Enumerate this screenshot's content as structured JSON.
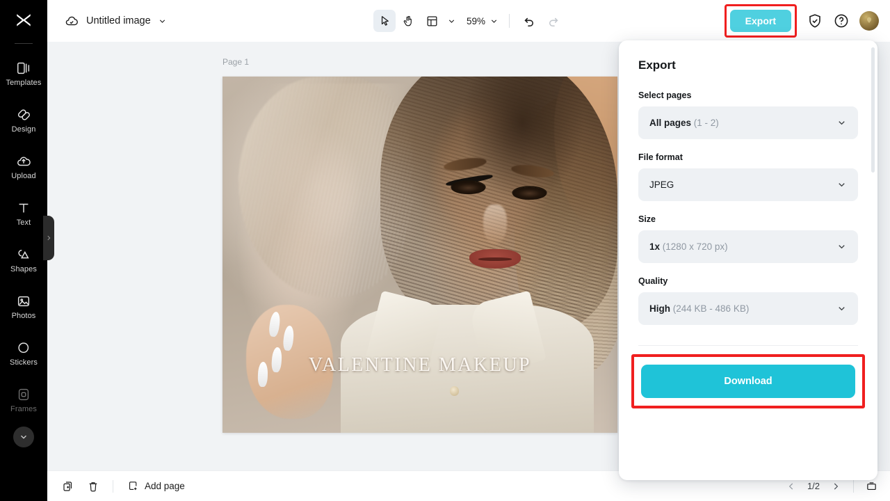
{
  "app": {
    "logo": "capcut-logo-icon"
  },
  "topbar": {
    "cloud_icon": "cloud-check-icon",
    "doc_title": "Untitled image",
    "title_chevron": "chevron-down-icon",
    "tools": [
      {
        "name": "select-tool",
        "icon": "cursor-arrow-icon"
      },
      {
        "name": "hand-tool",
        "icon": "hand-icon"
      },
      {
        "name": "layout-tool",
        "icon": "layout-grid-icon"
      }
    ],
    "zoom_level": "59%",
    "undo_icon": "undo-arrow-icon",
    "redo_icon": "redo-arrow-icon",
    "export_label": "Export",
    "shield_icon": "shield-check-icon",
    "help_icon": "question-circle-icon",
    "avatar": "user-avatar"
  },
  "sidebar": {
    "items": [
      {
        "label": "Templates",
        "icon": "templates-icon",
        "dim": false
      },
      {
        "label": "Design",
        "icon": "design-icon",
        "dim": false
      },
      {
        "label": "Upload",
        "icon": "upload-cloud-icon",
        "dim": false
      },
      {
        "label": "Text",
        "icon": "text-t-icon",
        "dim": false
      },
      {
        "label": "Shapes",
        "icon": "shapes-icon",
        "dim": false
      },
      {
        "label": "Photos",
        "icon": "photos-image-icon",
        "dim": false
      },
      {
        "label": "Stickers",
        "icon": "sticker-icon",
        "dim": false
      },
      {
        "label": "Frames",
        "icon": "frames-icon",
        "dim": true
      }
    ],
    "more_icon": "chevron-down-icon",
    "collapse_icon": "chevron-right-icon"
  },
  "canvas": {
    "page_label": "Page 1",
    "artwork_title": "VALENTINE MAKEUP"
  },
  "bottombar": {
    "duplicate_icon": "duplicate-page-icon",
    "delete_icon": "trash-icon",
    "add_page_icon": "add-page-icon",
    "add_page_label": "Add page",
    "prev_icon": "chevron-left-icon",
    "next_icon": "chevron-right-icon",
    "page_count": "1/2",
    "grid_view_icon": "page-view-icon"
  },
  "export_panel": {
    "title": "Export",
    "fields": [
      {
        "label": "Select pages",
        "value_strong": "All pages",
        "value_muted": "(1 - 2)",
        "chevron": "chevron-down-icon"
      },
      {
        "label": "File format",
        "value_strong": "",
        "value_muted": "JPEG",
        "chevron": "chevron-down-icon"
      },
      {
        "label": "Size",
        "value_strong": "1x",
        "value_muted": "(1280 x 720 px)",
        "chevron": "chevron-down-icon"
      },
      {
        "label": "Quality",
        "value_strong": "High",
        "value_muted": "(244 KB - 486 KB)",
        "chevron": "chevron-down-icon"
      }
    ],
    "download_label": "Download"
  },
  "colors": {
    "accent_cyan": "#1fc3d8",
    "export_button": "#4fd0e0",
    "highlight_red": "#f01f1f",
    "sidebar_bg": "#000000",
    "canvas_bg": "#f1f3f5"
  }
}
